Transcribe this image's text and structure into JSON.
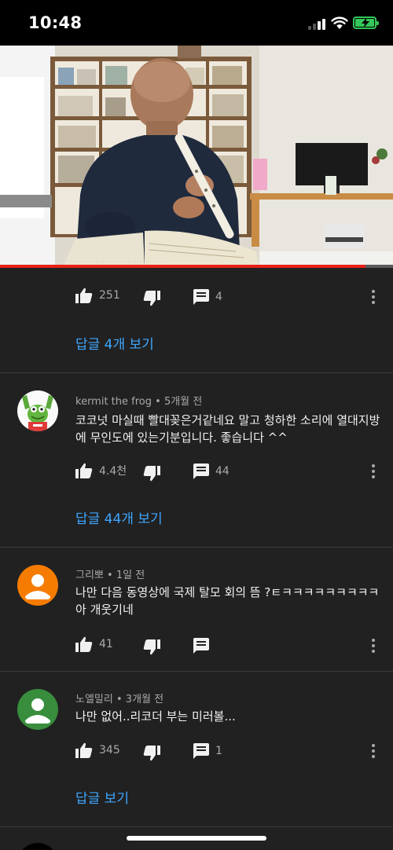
{
  "status_bar": {
    "time": "10:48"
  },
  "video": {
    "progress_fraction": 0.93
  },
  "comments": [
    {
      "likes": "251",
      "replies_count": "4",
      "view_replies": "답글 4개 보기"
    },
    {
      "author": "kermit the frog",
      "time": "5개월 전",
      "text": "코코넛 마실때 빨대꽂은거같네요 말고 청하한 소리에 열대지방에 무인도에 있는기분입니다. 좋습니다 ^^",
      "likes": "4.4천",
      "replies_count": "44",
      "view_replies": "답글 44개 보기"
    },
    {
      "author": "그리뽀",
      "time": "1일 전",
      "text": "나만 다음 동영상에 국제 탈모 회의 뜸 ?ㅌㅋㅋㅋㅋㅋㅋㅋㅋㅋ아 개웃기네",
      "likes": "41",
      "avatar_color": "#f57c00"
    },
    {
      "author": "노엘밀리",
      "time": "3개월 전",
      "text": "나만 없어..리코더 부는 미러볼...",
      "likes": "345",
      "replies_count": "1",
      "view_replies": "답글 보기",
      "avatar_color": "#388e3c"
    }
  ],
  "icons": {
    "like": "thumbs-up-icon",
    "dislike": "thumbs-down-icon",
    "reply": "reply-comment-icon",
    "more": "more-vertical-icon"
  }
}
